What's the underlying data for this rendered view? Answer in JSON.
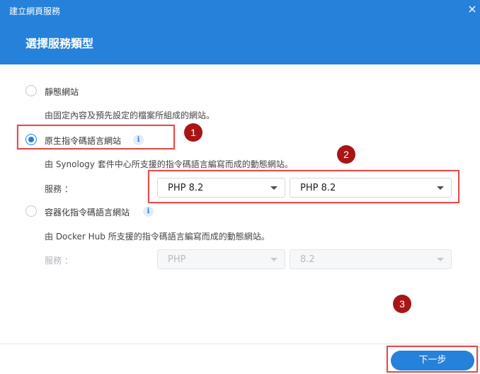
{
  "window": {
    "title": "建立網頁服務",
    "close_icon": "×"
  },
  "step": {
    "title": "選擇服務類型"
  },
  "options": [
    {
      "label": "靜態網站",
      "checked": false,
      "description": "由固定內容及預先設定的檔案所組成的網站。"
    },
    {
      "label": "原生指令碼語言網站",
      "checked": true,
      "description": "由 Synology 套件中心所支援的指令碼語言編寫而成的動態網站。",
      "service_label": "服務 ：",
      "service_value": "PHP 8.2",
      "version_value": "PHP 8.2"
    },
    {
      "label": "容器化指令碼語言網站",
      "checked": false,
      "description": "由 Docker Hub 所支援的指令碼語言編寫而成的動態網站。",
      "service_label": "服務 ：",
      "service_value": "PHP",
      "version_value": "8.2"
    }
  ],
  "annotations": {
    "badge1": "1",
    "badge2": "2",
    "badge3": "3"
  },
  "footer": {
    "next_label": "下一步"
  },
  "colors": {
    "accent": "#2581d9",
    "highlight": "#e24c4c",
    "badge": "#a91515"
  }
}
